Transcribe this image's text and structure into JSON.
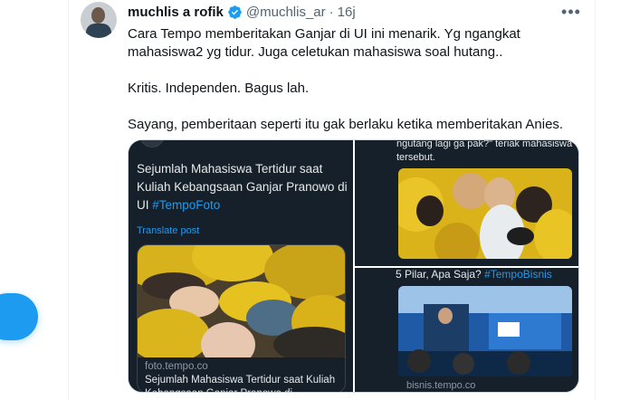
{
  "user": {
    "name": "muchlis a rofik",
    "handle": "@muchlis_ar",
    "separator": "·",
    "time": "16j",
    "verified_color": "#1d9bf0"
  },
  "more_label": "•••",
  "tweet": {
    "paragraphs": [
      "Cara Tempo memberitakan Ganjar di UI ini menarik. Yg ngangkat",
      "mahasiswa2 yg tidur. Juga celetukan mahasiswa soal hutang..",
      "Kritis. Independen. Bagus lah.",
      "Sayang, pemberitaan seperti itu gak berlaku ketika memberitakan Anies."
    ]
  },
  "media": {
    "quote": {
      "title_text": "Sejumlah Mahasiswa Tertidur saat Kuliah Kebangsaan Ganjar Pranowo di UI ",
      "hashtag": "#TempoFoto",
      "translate": "Translate post",
      "card_domain": "foto.tempo.co",
      "card_title": "Sejumlah Mahasiswa Tertidur saat Kuliah Kebangsaan Ganjar Pranowo di"
    },
    "top_right": {
      "text": "ngutang lagi ga pak?\" teriak mahasiswa tersebut."
    },
    "bottom_right": {
      "text": "5 Pilar, Apa Saja? ",
      "hashtag": "#TempoBisnis",
      "domain": "bisnis.tempo.co"
    }
  },
  "colors": {
    "accent": "#1d9bf0",
    "dark_bg": "#15202b",
    "secondary_text": "#536471"
  }
}
